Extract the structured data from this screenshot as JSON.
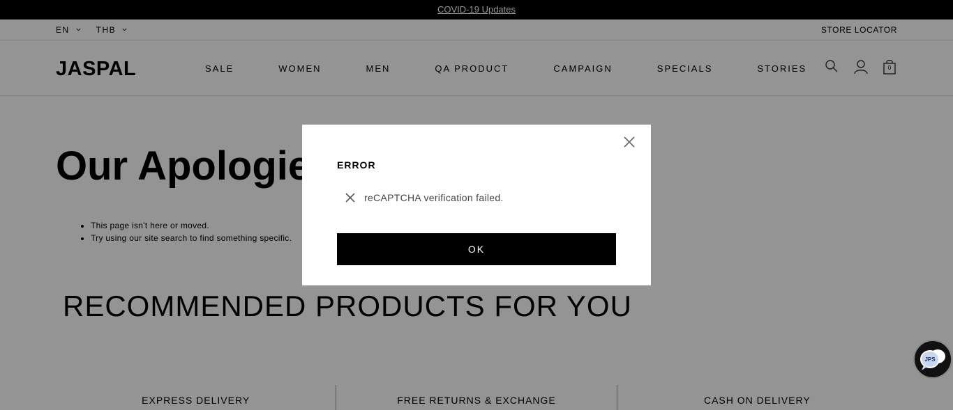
{
  "announcement": {
    "link_label": "COVID-19 Updates"
  },
  "utility_bar": {
    "language": "EN",
    "currency": "THB",
    "store_locator": "STORE LOCATOR"
  },
  "header": {
    "logo": "JASPAL",
    "nav": [
      "SALE",
      "WOMEN",
      "MEN",
      "QA PRODUCT",
      "CAMPAIGN",
      "SPECIALS",
      "STORIES"
    ],
    "icons": [
      "search-icon",
      "account-icon",
      "bag-icon"
    ],
    "cart_count": "0"
  },
  "page": {
    "title": "Our Apologies",
    "bullets": [
      "This page isn't here or moved.",
      "Try using our site search to find something specific."
    ],
    "recommend_title": "RECOMMENDED PRODUCTS FOR YOU",
    "features": [
      "EXPRESS DELIVERY",
      "FREE RETURNS & EXCHANGE",
      "CASH ON DELIVERY"
    ]
  },
  "modal": {
    "title": "ERROR",
    "message": "reCAPTCHA verification failed.",
    "ok_label": "OK"
  },
  "chat": {
    "badge": "JPS"
  }
}
